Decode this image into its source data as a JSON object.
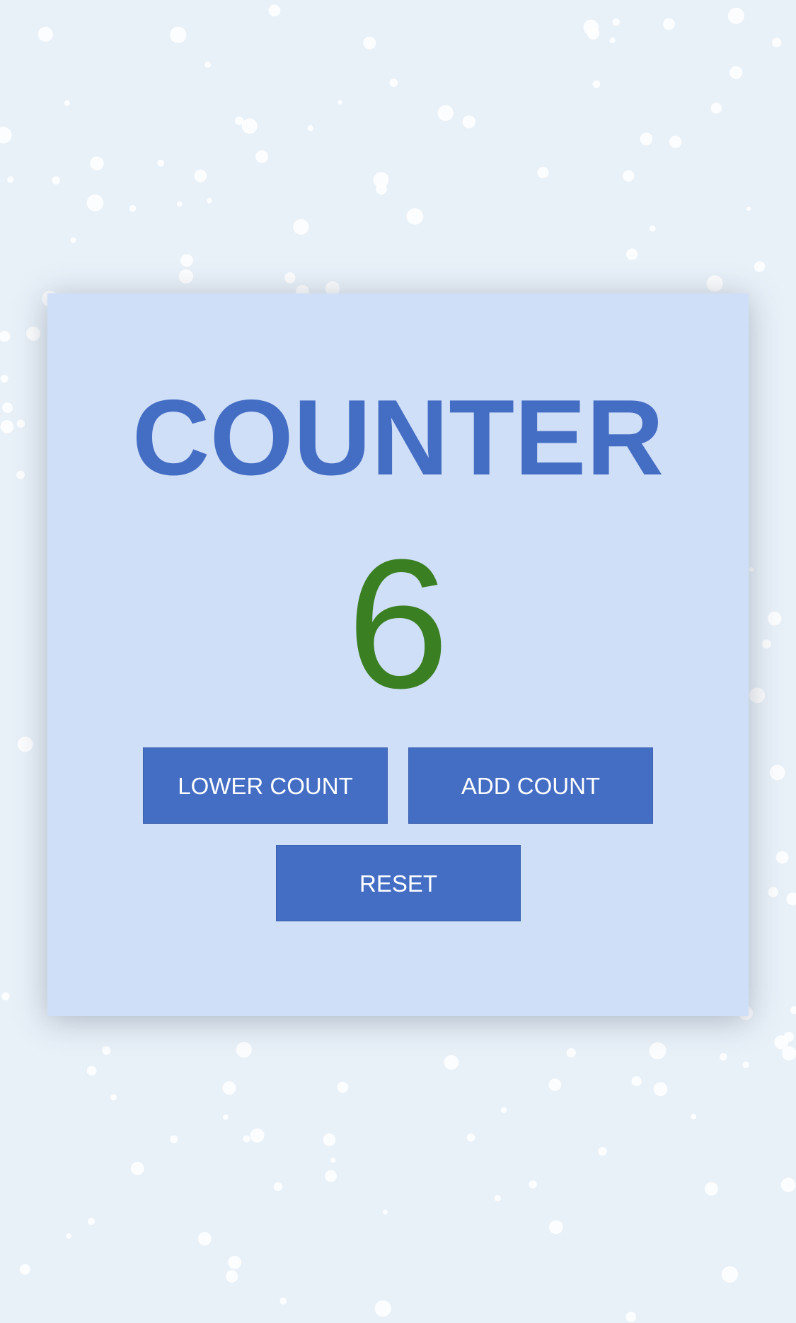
{
  "counter": {
    "title": "COUNTER",
    "value": "6",
    "value_color": "#3a7f22"
  },
  "buttons": {
    "lower_label": "LOWER COUNT",
    "add_label": "ADD COUNT",
    "reset_label": "RESET"
  },
  "colors": {
    "background": "#e8f0f8",
    "card": "#d0dff8",
    "accent": "#446dc4",
    "button_text": "#ffffff"
  }
}
